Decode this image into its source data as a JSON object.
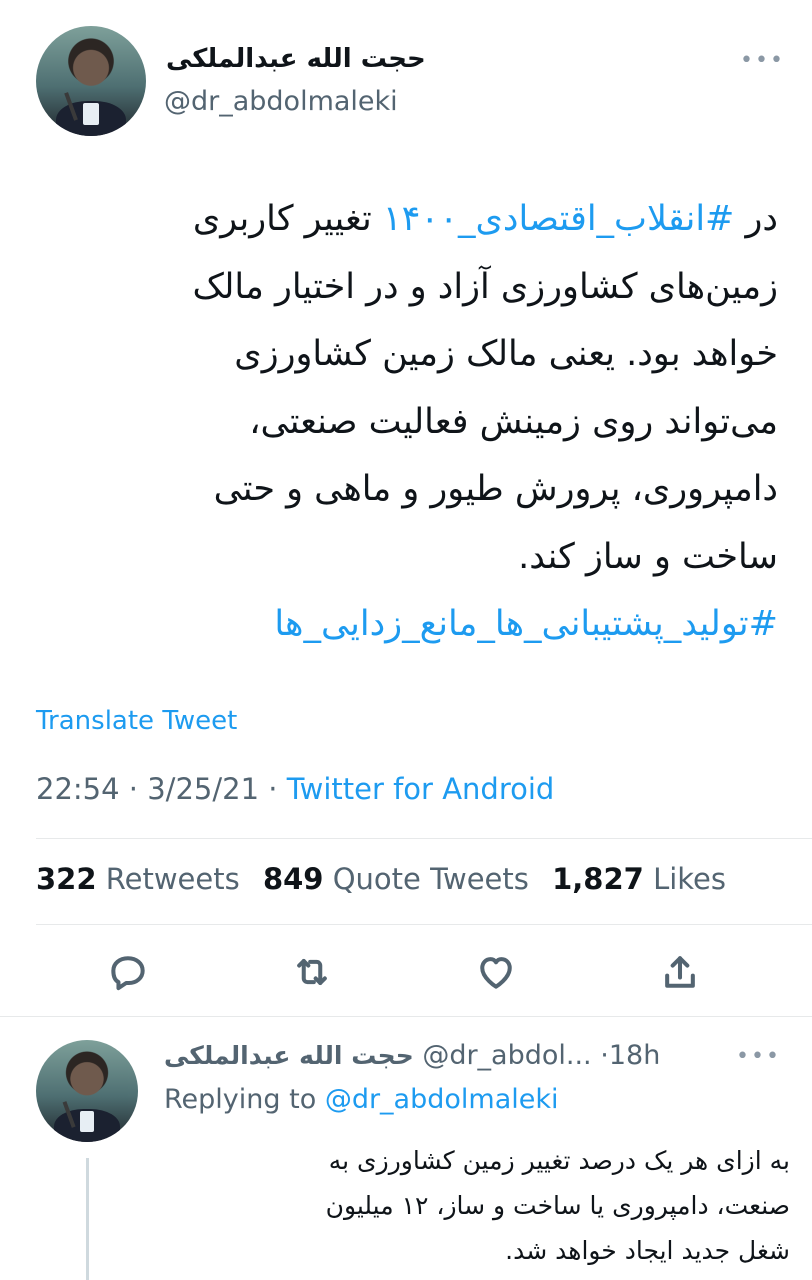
{
  "tweet": {
    "author_name": "حجت الله عبدالملکی",
    "handle": "@dr_abdolmaleki",
    "more_icon": "more-horizontal-icon",
    "text_lines": [
      {
        "before": "در ",
        "hashtag": "#انقلاب_اقتصادی_۱۴۰۰",
        "after": " تغییر کاربری"
      },
      {
        "text": "زمین‌های کشاورزی آزاد و در اختیار مالک"
      },
      {
        "text": "خواهد بود. یعنی مالک زمین کشاورزی"
      },
      {
        "text": "می‌تواند روی زمینش فعالیت صنعتی،"
      },
      {
        "text": "دامپروری، پرورش طیور و ماهی و حتی"
      },
      {
        "text": "ساخت و ساز کند."
      },
      {
        "hashtag": "#تولید_پشتیبانی_ها_مانع_زدایی_ها"
      }
    ],
    "translate_label": "Translate Tweet",
    "time": "22:54",
    "date": "3/25/21",
    "separator": "·",
    "source": "Twitter for Android",
    "stats": {
      "retweets_count": "322",
      "retweets_label": "Retweets",
      "quotes_count": "849",
      "quotes_label": "Quote Tweets",
      "likes_count": "1,827",
      "likes_label": "Likes"
    },
    "actions": [
      "reply-icon",
      "retweet-icon",
      "like-icon",
      "share-icon"
    ]
  },
  "reply": {
    "author_name": "حجت الله عبدالملکی",
    "handle": "@dr_abdol...",
    "separator": "·",
    "time": "18h",
    "replying_prefix": "Replying to",
    "replying_handle": "@dr_abdolmaleki",
    "text_lines": [
      "به ازای هر یک درصد تغییر زمین کشاورزی به",
      "صنعت، دامپروری یا ساخت و ساز، ۱۲ میلیون",
      "شغل جدید ایجاد خواهد شد."
    ]
  },
  "colors": {
    "accent": "#1d9bf0",
    "secondary_text": "#536471",
    "primary_text": "#0f1419",
    "divider": "#e7e9ea"
  }
}
